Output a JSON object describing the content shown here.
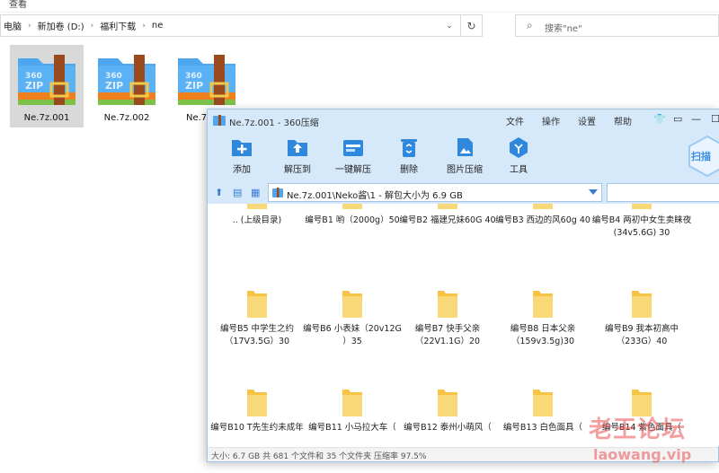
{
  "explorer": {
    "menu_label": "查看",
    "breadcrumbs": [
      "电脑",
      "新加卷 (D:)",
      "福利下载",
      "ne"
    ],
    "search_placeholder": "搜索\"ne\"",
    "files": [
      {
        "name": "Ne.7z.001",
        "selected": true
      },
      {
        "name": "Ne.7z.002",
        "selected": false
      },
      {
        "name": "Ne.7",
        "selected": false
      }
    ]
  },
  "archive_window": {
    "title": "Ne.7z.001 - 360压缩",
    "menu": [
      "文件",
      "操作",
      "设置",
      "帮助"
    ],
    "toolbar": {
      "add": "添加",
      "extract_to": "解压到",
      "one_click_extract": "一键解压",
      "delete": "删除",
      "image_compress": "图片压缩",
      "tools": "工具",
      "scan": "扫描"
    },
    "path": "Ne.7z.001\\Neko酱\\1 - 解包大小为 6.9 GB",
    "entries": [
      ".. (上级目录)",
      "编号B1  哟（2000g）50",
      "编号B2 福建兄妹60G 40",
      "编号B3    西边的风60g 40",
      "编号B4 两初中女生卖睐夜(34v5.6G) 30",
      "编号B5 中学生之约（17V3.5G）30",
      "编号B6 小表妹（20v12G ）35",
      "编号B7 快手父亲（22V1.1G）20",
      "编号B8 日本父亲（159v3.5g)30",
      "编号B9 我本初高中（233G）40",
      "编号B10 T先生约未成年",
      "编号B11 小马拉大车（",
      "编号B12 泰州小萌风（",
      "编号B13 白色面具（",
      "编号B14 紫色面具（"
    ],
    "status": "大小: 6.7 GB 共 681 个文件和 35 个文件夹 压缩率 97.5%"
  },
  "watermark": {
    "line1": "老王论坛",
    "line2": "laowang.vip"
  },
  "colors": {
    "toolbar_bg": "#d6e9fb",
    "accent_blue": "#3a8de0",
    "folder_yellow": "#f6c343",
    "zip_orange": "#f0801e",
    "selection_gray": "#d9d9d9"
  }
}
